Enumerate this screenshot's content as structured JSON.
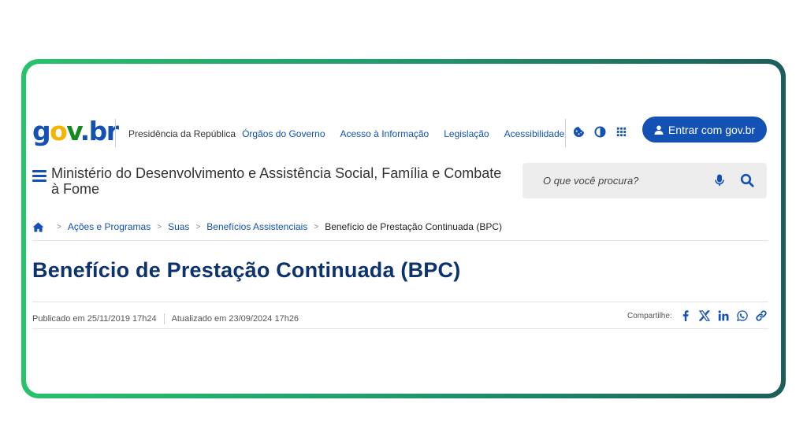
{
  "header": {
    "logo": {
      "g": "g",
      "o": "o",
      "v": "v",
      "dot": ".",
      "b": "b",
      "r": "r"
    },
    "presidencia": "Presidência da República",
    "nav_links": [
      "Órgãos do Governo",
      "Acesso à Informação",
      "Legislação",
      "Acessibilidade"
    ],
    "tool_icons": [
      "cookie-icon",
      "contrast-icon",
      "apps-grid-icon"
    ],
    "login_label": "Entrar com gov.br"
  },
  "ministry": {
    "name": "Ministério do Desenvolvimento e Assistência Social, Família e Combate à Fome"
  },
  "search": {
    "placeholder": "O que você procura?"
  },
  "breadcrumb": {
    "items": [
      "Ações e Programas",
      "Suas",
      "Benefícios Assistenciais"
    ],
    "current": "Benefício de Prestação Continuada (BPC)",
    "separator": ">"
  },
  "page": {
    "title": "Benefício de Prestação Continuada (BPC)",
    "published": "Publicado em 25/11/2019 17h24",
    "updated": "Atualizado em 23/09/2024 17h26",
    "share_label": "Compartilhe:",
    "share_icons": [
      "facebook-icon",
      "x-icon",
      "linkedin-icon",
      "whatsapp-icon",
      "link-icon"
    ]
  },
  "colors": {
    "primary": "#1351b4",
    "title": "#0c326f",
    "frame_start": "#27c26a",
    "frame_end": "#1b5e5a"
  }
}
